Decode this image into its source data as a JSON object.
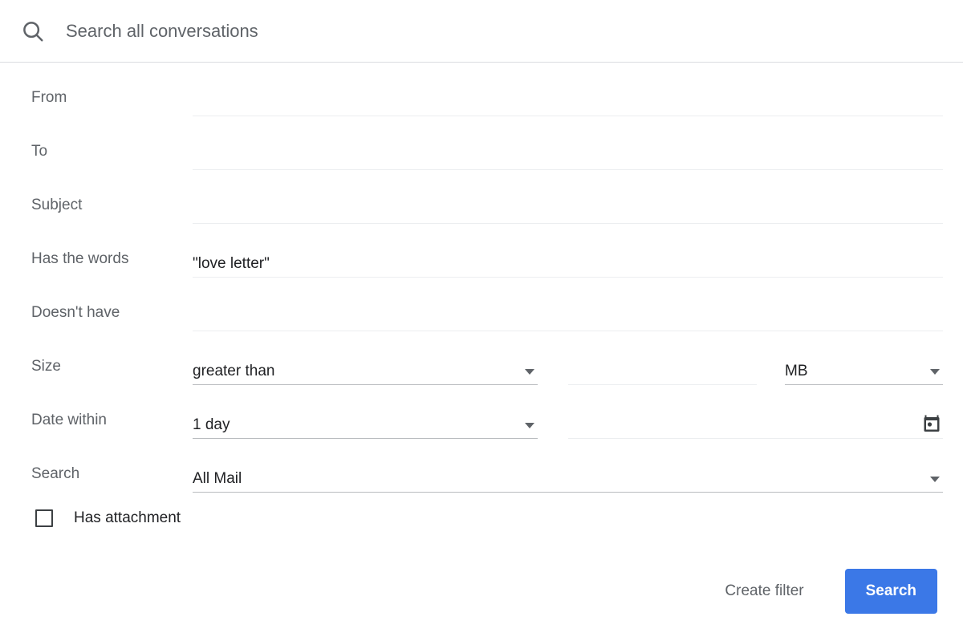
{
  "search_bar": {
    "icon": "search-icon",
    "placeholder": "Search all conversations",
    "value": ""
  },
  "fields": {
    "from": {
      "label": "From",
      "value": ""
    },
    "to": {
      "label": "To",
      "value": ""
    },
    "subject": {
      "label": "Subject",
      "value": ""
    },
    "has_words": {
      "label": "Has the words",
      "value": "\"love letter\""
    },
    "doesnt_have": {
      "label": "Doesn't have",
      "value": ""
    },
    "size": {
      "label": "Size",
      "operator": "greater than",
      "amount": "",
      "unit": "MB"
    },
    "date_within": {
      "label": "Date within",
      "range": "1 day",
      "date": "",
      "calendar_icon": "calendar-icon"
    },
    "search_scope": {
      "label": "Search",
      "value": "All Mail"
    }
  },
  "has_attachment": {
    "label": "Has attachment",
    "checked": false
  },
  "actions": {
    "create_filter": "Create filter",
    "search": "Search"
  },
  "colors": {
    "accent": "#3b78e7",
    "label_text": "#5f6368",
    "value_text": "#202124",
    "underline_light": "#eceef0",
    "underline_dark": "#b9bcbf",
    "header_border": "#dadce0"
  }
}
